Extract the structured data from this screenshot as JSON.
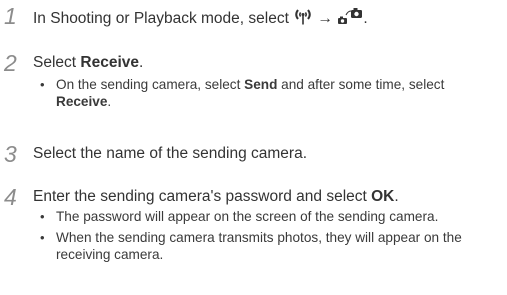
{
  "steps": [
    {
      "num": "1",
      "text_before": "In Shooting or Playback mode, select",
      "arrow": "→",
      "period": "."
    },
    {
      "num": "2",
      "text_before": "Select ",
      "bold": "Receive",
      "text_after": ".",
      "bullet": {
        "before": "On the sending camera, select ",
        "bold1": "Send",
        "middle": " and after some time, select ",
        "bold2": "Receive",
        "after": "."
      }
    },
    {
      "num": "3",
      "text": "Select the name of the sending camera."
    },
    {
      "num": "4",
      "text_before": "Enter the sending camera's password and select ",
      "bold": "OK",
      "text_after": ".",
      "bullets": [
        "The password will appear on the screen of the sending camera.",
        "When the sending camera transmits photos, they will appear on the receiving camera."
      ]
    }
  ],
  "icons": [
    "wireless-icon",
    "camera-share-icon"
  ]
}
